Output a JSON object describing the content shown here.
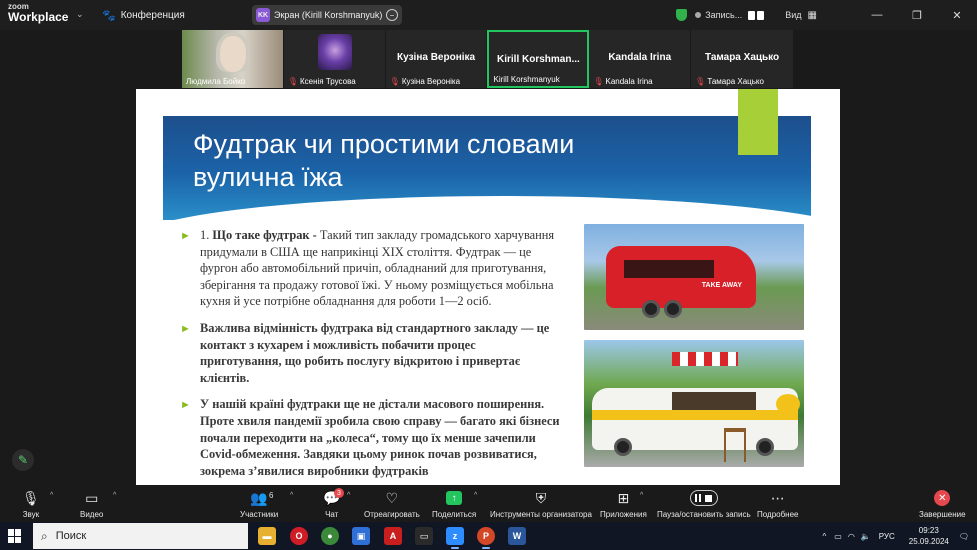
{
  "titlebar": {
    "logo_line1": "zoom",
    "logo_line2": "Workplace",
    "conference_label": "Конференция",
    "screen_share_label": "Экран (Kirill Korshmanyuk)",
    "screen_share_initials": "KK",
    "recording_label": "Запись...",
    "view_label": "Вид"
  },
  "participants": [
    {
      "display": "",
      "caption": "Людмила Бойко",
      "muted": false,
      "active": false,
      "has_video": true
    },
    {
      "display": "",
      "caption": "Ксенія Трусова",
      "muted": true,
      "active": false,
      "has_video": true
    },
    {
      "display": "Кузіна Вероніка",
      "caption": "Кузіна Вероніка",
      "muted": true,
      "active": false,
      "has_video": false
    },
    {
      "display": "Kirill Korshman...",
      "caption": "Kirill Korshmanyuk",
      "muted": false,
      "active": true,
      "has_video": false
    },
    {
      "display": "Kandala Irina",
      "caption": "Kandala Irina",
      "muted": true,
      "active": false,
      "has_video": false
    },
    {
      "display": "Тамара Хацько",
      "caption": "Тамара Хацько",
      "muted": true,
      "active": false,
      "has_video": false
    }
  ],
  "slide": {
    "title": "Фудтрак чи простими словами вулична їжа",
    "bullet1_num": "1. ",
    "bullet1_lead": "Що таке фудтрак - ",
    "bullet1_text": "Такий тип закладу громадського харчування придумали в США ще наприкінці XIX століття. Фудтрак — це фургон або автомобільний причіп, обладнаний для приготування, зберігання та продажу готової їжі. У ньому розміщується мобільна кухня й усе потрібне обладнання для роботи 1—2 осіб.",
    "bullet2_text": "Важлива відмінність фудтрака від стандартного закладу — це контакт з кухарем і можливість побачити процес приготування, що робить послугу відкритою і привертає клієнтів.",
    "bullet3_text": "У нашій країні фудтраки ще не дістали масового поширення. Проте хвиля пандемії зробила свою справу — багато які бізнеси почали переходити на „колеса“, тому що їх менше зачепили Covid-обмеження. Завдяки цьому ринок почав розвиватися, зокрема з’явилися виробники фудтраків",
    "photo1_sign": "TAKE AWAY"
  },
  "toolbar": {
    "audio": "Звук",
    "video": "Видео",
    "participants": "Участники",
    "participants_count": "6",
    "chat": "Чат",
    "chat_badge": "3",
    "react": "Отреагировать",
    "share": "Поделиться",
    "host_tools": "Инструменты организатора",
    "apps": "Приложения",
    "pause_record": "Пауза/остановить запись",
    "more": "Подробнее",
    "end": "Завершение"
  },
  "taskbar": {
    "search_placeholder": "Поиск",
    "lang": "РУС",
    "time": "09:23",
    "date": "25.09.2024"
  },
  "colors": {
    "accent_green": "#22c55e",
    "slide_banner": "#1b63a8",
    "slide_green_tab": "#a6cf38",
    "end_red": "#e5484d"
  }
}
